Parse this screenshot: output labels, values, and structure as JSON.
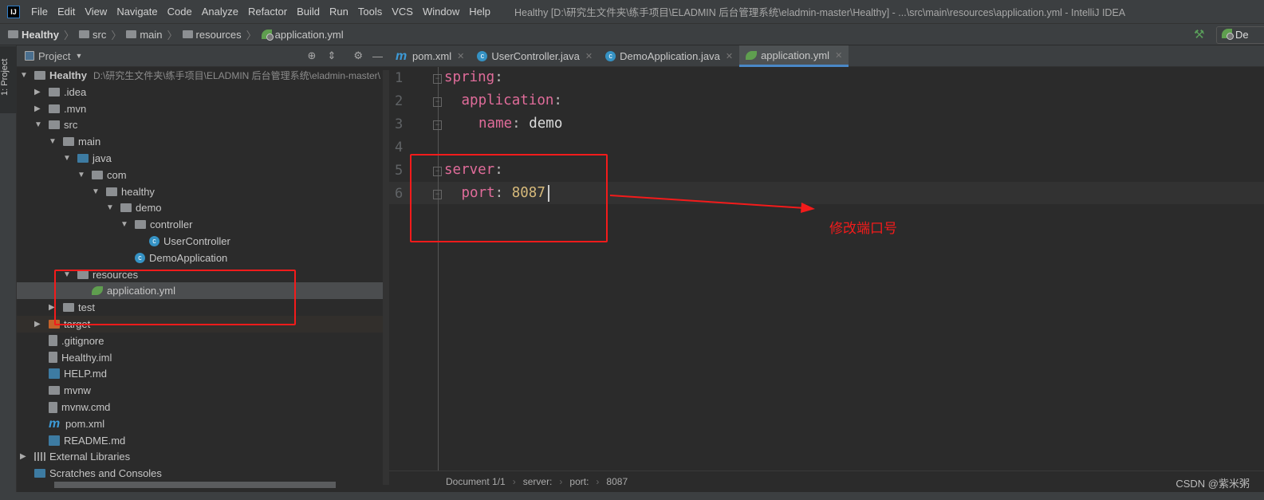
{
  "menubar": {
    "items": [
      "File",
      "Edit",
      "View",
      "Navigate",
      "Code",
      "Analyze",
      "Refactor",
      "Build",
      "Run",
      "Tools",
      "VCS",
      "Window",
      "Help"
    ],
    "title": "Healthy [D:\\研究生文件夹\\练手项目\\ELADMIN 后台管理系统\\eladmin-master\\Healthy] - ...\\src\\main\\resources\\application.yml - IntelliJ IDEA",
    "logo": "IJ"
  },
  "breadcrumb": [
    "Healthy",
    "src",
    "main",
    "resources",
    "application.yml"
  ],
  "run_config": "De",
  "sidebar": {
    "tab": "1: Project",
    "panel_title": "Project"
  },
  "tree": [
    {
      "label": "Healthy",
      "depth": 0,
      "arrow": "down",
      "icon": "module",
      "path": "D:\\研究生文件夹\\练手项目\\ELADMIN 后台管理系统\\eladmin-master\\"
    },
    {
      "label": ".idea",
      "depth": 1,
      "arrow": "right",
      "icon": "folder"
    },
    {
      "label": ".mvn",
      "depth": 1,
      "arrow": "right",
      "icon": "folder"
    },
    {
      "label": "src",
      "depth": 1,
      "arrow": "down",
      "icon": "folder"
    },
    {
      "label": "main",
      "depth": 2,
      "arrow": "down",
      "icon": "folder"
    },
    {
      "label": "java",
      "depth": 3,
      "arrow": "down",
      "icon": "source-folder"
    },
    {
      "label": "com",
      "depth": 4,
      "arrow": "down",
      "icon": "package"
    },
    {
      "label": "healthy",
      "depth": 5,
      "arrow": "down",
      "icon": "package"
    },
    {
      "label": "demo",
      "depth": 6,
      "arrow": "down",
      "icon": "package"
    },
    {
      "label": "controller",
      "depth": 7,
      "arrow": "down",
      "icon": "package"
    },
    {
      "label": "UserController",
      "depth": 8,
      "arrow": "",
      "icon": "class"
    },
    {
      "label": "DemoApplication",
      "depth": 7,
      "arrow": "",
      "icon": "spring-class"
    },
    {
      "label": "resources",
      "depth": 3,
      "arrow": "down",
      "icon": "resources-folder"
    },
    {
      "label": "application.yml",
      "depth": 4,
      "arrow": "",
      "icon": "spring-yml",
      "selected": true
    },
    {
      "label": "test",
      "depth": 2,
      "arrow": "right",
      "icon": "folder"
    },
    {
      "label": "target",
      "depth": 1,
      "arrow": "right",
      "icon": "excluded-folder"
    },
    {
      "label": ".gitignore",
      "depth": 1,
      "arrow": "",
      "icon": "file"
    },
    {
      "label": "Healthy.iml",
      "depth": 1,
      "arrow": "",
      "icon": "file"
    },
    {
      "label": "HELP.md",
      "depth": 1,
      "arrow": "",
      "icon": "markdown"
    },
    {
      "label": "mvnw",
      "depth": 1,
      "arrow": "",
      "icon": "shell"
    },
    {
      "label": "mvnw.cmd",
      "depth": 1,
      "arrow": "",
      "icon": "file"
    },
    {
      "label": "pom.xml",
      "depth": 1,
      "arrow": "",
      "icon": "maven"
    },
    {
      "label": "README.md",
      "depth": 1,
      "arrow": "",
      "icon": "markdown"
    },
    {
      "label": "External Libraries",
      "depth": 0,
      "arrow": "right",
      "icon": "libraries"
    },
    {
      "label": "Scratches and Consoles",
      "depth": 0,
      "arrow": "",
      "icon": "scratches"
    }
  ],
  "tabs": [
    {
      "label": "pom.xml",
      "icon": "maven"
    },
    {
      "label": "UserController.java",
      "icon": "class"
    },
    {
      "label": "DemoApplication.java",
      "icon": "spring-class"
    },
    {
      "label": "application.yml",
      "icon": "spring-yml",
      "active": true
    }
  ],
  "code": {
    "lines": [
      {
        "num": "1",
        "key": "spring",
        "indent": 0
      },
      {
        "num": "2",
        "key": "application",
        "indent": 1
      },
      {
        "num": "3",
        "key": "name",
        "indent": 2,
        "value": "demo"
      },
      {
        "num": "4"
      },
      {
        "num": "5",
        "key": "server",
        "indent": 0
      },
      {
        "num": "6",
        "key": "port",
        "indent": 1,
        "value": "8087",
        "numeric": true
      }
    ]
  },
  "status": {
    "crumbs": [
      "Document 1/1",
      "server:",
      "port:",
      "8087"
    ],
    "watermark": "CSDN @紫米粥"
  },
  "annotation": {
    "text": "修改端口号",
    "color": "#f31b1b"
  }
}
